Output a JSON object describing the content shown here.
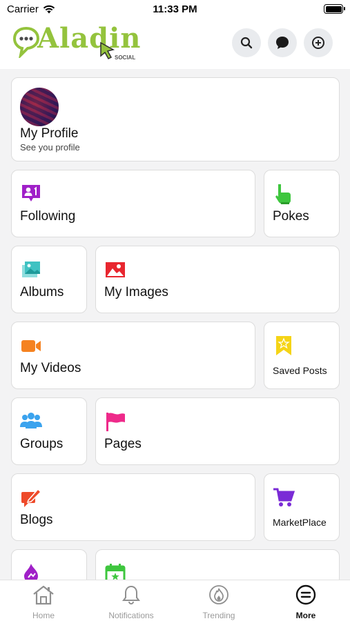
{
  "status_bar": {
    "carrier": "Carrier",
    "time": "11:33 PM"
  },
  "header": {
    "logo_text": "Aladin",
    "logo_sub": "SOCIAL",
    "buttons": [
      {
        "icon": "search-icon"
      },
      {
        "icon": "chat-bubble-icon"
      },
      {
        "icon": "add-circle-icon"
      }
    ]
  },
  "profile": {
    "title": "My Profile",
    "subtitle": "See you profile"
  },
  "menu": {
    "following": "Following",
    "pokes": "Pokes",
    "albums": "Albums",
    "my_images": "My Images",
    "my_videos": "My Videos",
    "saved_posts": "Saved Posts",
    "groups": "Groups",
    "pages": "Pages",
    "blogs": "Blogs",
    "marketplace": "MarketPlace"
  },
  "tabs": [
    {
      "label": "Home",
      "icon": "home-icon"
    },
    {
      "label": "Notifications",
      "icon": "bell-icon"
    },
    {
      "label": "Trending",
      "icon": "flame-icon"
    },
    {
      "label": "More",
      "icon": "menu-circle-icon",
      "active": true
    }
  ],
  "colors": {
    "brand_green": "#94c33d",
    "following_purple": "#a020c8",
    "pokes_green": "#3ec63e",
    "albums_teal": "#3fc2c2",
    "images_red": "#e8262f",
    "videos_orange": "#f58220",
    "saved_yellow": "#f5d416",
    "groups_blue": "#3ba3ee",
    "pages_pink": "#ee2a8a",
    "blogs_red": "#ee4a2a",
    "marketplace_purple": "#7a2bd6"
  }
}
